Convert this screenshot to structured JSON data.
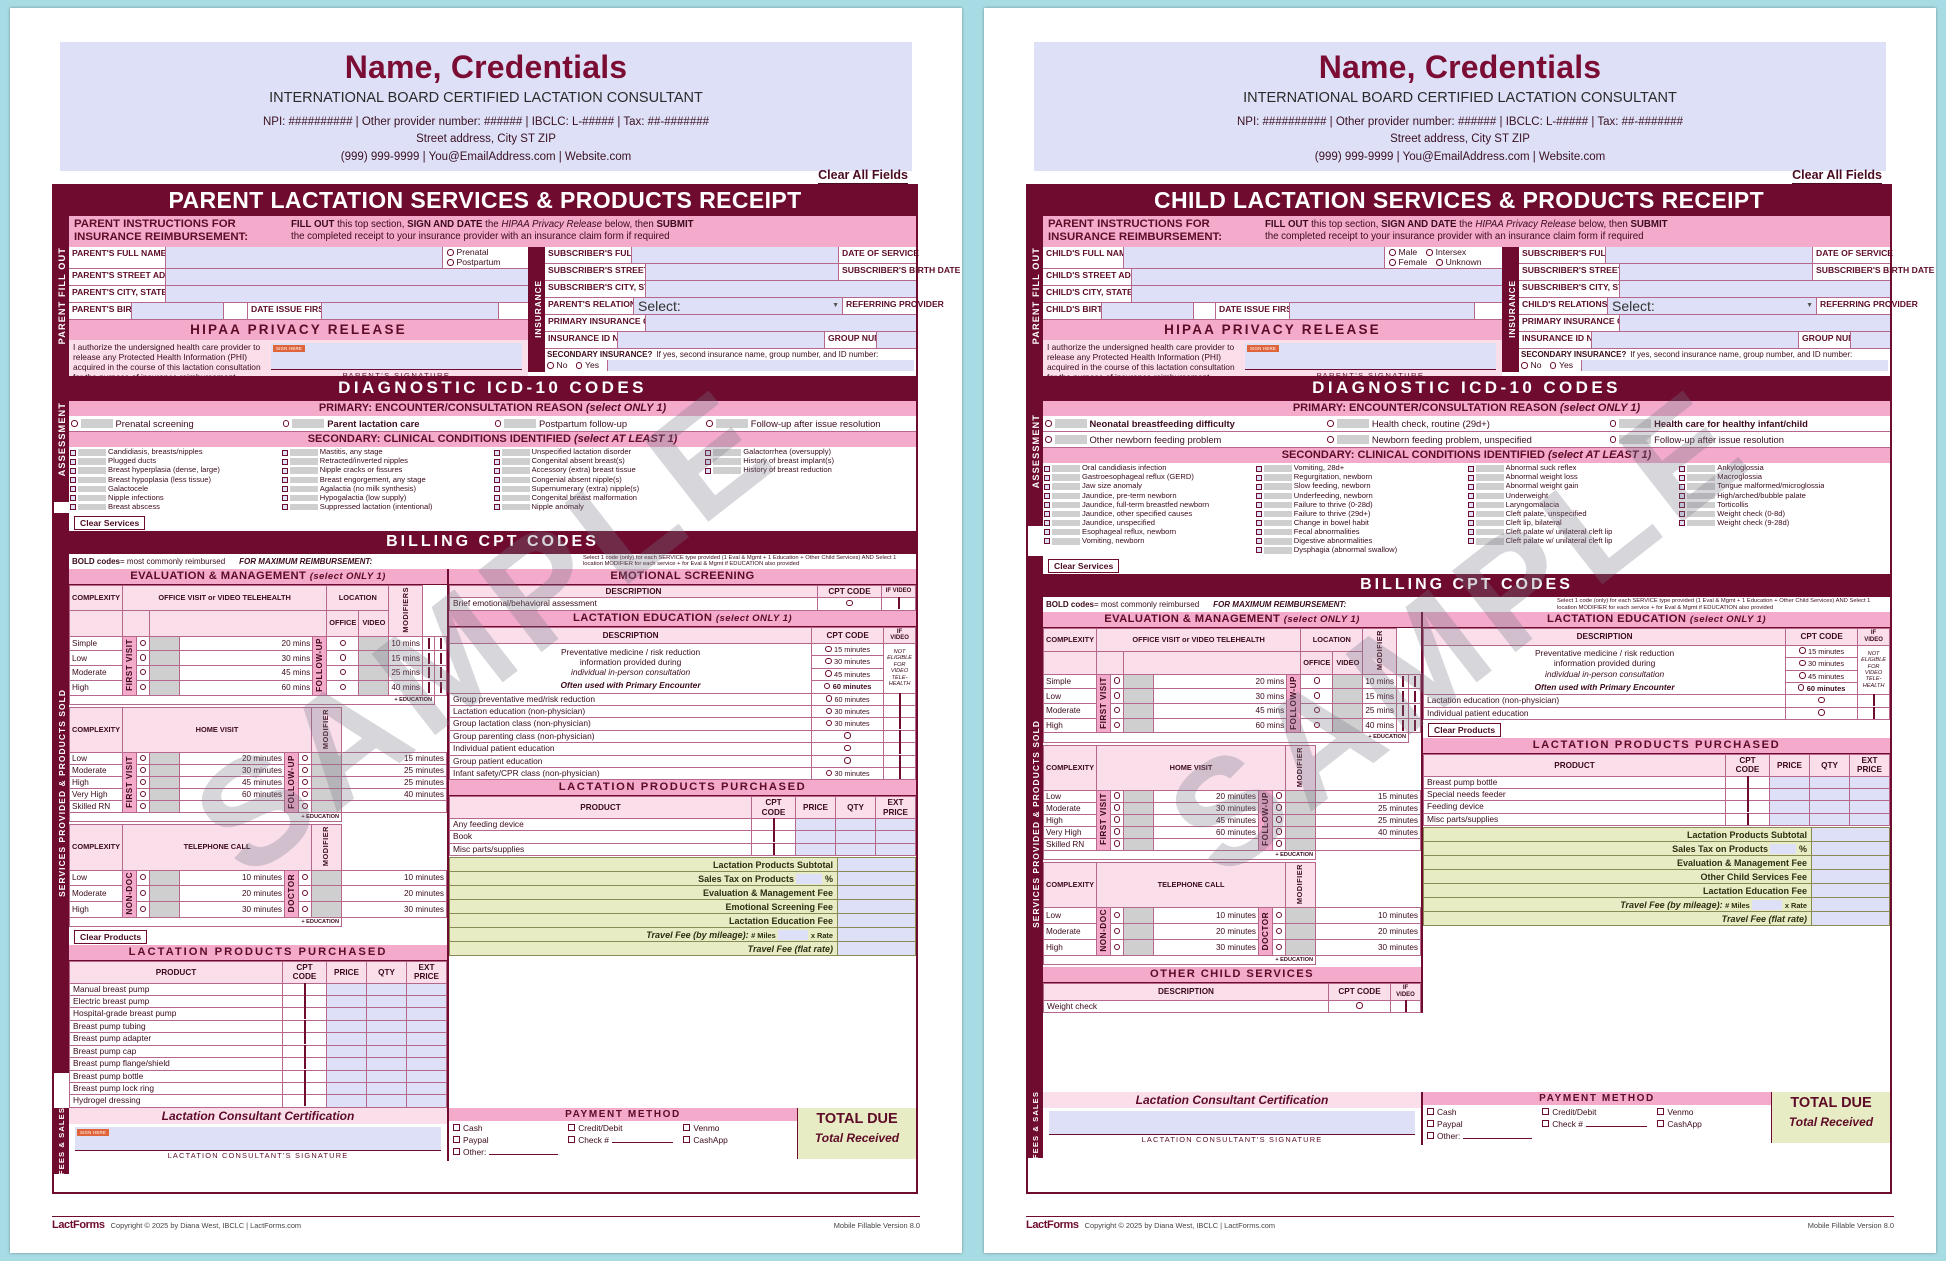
{
  "letterhead": {
    "name": "Name, Credentials",
    "subtitle": "INTERNATIONAL BOARD CERTIFIED LACTATION CONSULTANT",
    "ids": "NPI: ########## | Other provider number: ###### | IBCLC: L-##### | Tax: ##-#######",
    "address": "Street address, City ST ZIP",
    "contact": "(999) 999-9999 | You@EmailAddress.com | Website.com"
  },
  "clear_all_label": "Clear All Fields",
  "watermark": "SAMPLE",
  "forms": {
    "parent": {
      "title": "PARENT LACTATION SERVICES & PRODUCTS RECEIPT",
      "spine_fill": "PARENT FILL OUT",
      "spine_assess": "ASSESSMENT",
      "spine_services": "SERVICES PROVIDED & PRODUCTS SOLD",
      "spine_fees": "FEES & SALES",
      "spine_insurance": "INSURANCE",
      "instructions_label": "PARENT INSTRUCTIONS FOR INSURANCE REIMBURSEMENT:",
      "instructions_l1_a": "FILL OUT",
      "instructions_l1_b": " this top section, ",
      "instructions_l1_c": "SIGN AND DATE",
      "instructions_l1_d": " the ",
      "instructions_l1_e": "HIPAA Privacy Release",
      "instructions_l1_f": " below, then ",
      "instructions_l1_g": "SUBMIT",
      "instructions_l2": "the completed receipt to your insurance provider with an insurance claim form if required",
      "fields_left": [
        "PARENT'S FULL NAME",
        "PARENT'S STREET ADDRESS",
        "PARENT'S CITY, STATE, ZIP",
        "PARENT'S BIRTH DATE"
      ],
      "date_issue_label": "DATE ISSUE FIRST BEGAN",
      "radio_options": [
        "Prenatal",
        "Postpartum"
      ],
      "fields_right": [
        "SUBSCRIBER'S FULL NAME",
        "SUBSCRIBER'S STREET ADDRESS (if different)",
        "SUBSCRIBER'S CITY, STATE, ZIP (if different)"
      ],
      "relationship_label": "PARENT'S RELATIONSHIP TO SUBSCRIBER",
      "select_placeholder": "Select:",
      "primary_ins_label": "PRIMARY INSURANCE COMPANY NAME",
      "ins_id_label": "INSURANCE ID NUMBER",
      "date_of_service_label": "DATE OF SERVICE",
      "subscriber_birth_label": "SUBSCRIBER'S BIRTH DATE",
      "referring_label": "REFERRING PROVIDER",
      "group_number_label": "GROUP NUMBER",
      "secondary_ins_q": "SECONDARY INSURANCE?",
      "secondary_ins_hint": "If yes, second insurance name, group number, and ID number:",
      "secondary_opts": [
        "No",
        "Yes"
      ],
      "hipaa_title": "HIPAA PRIVACY RELEASE",
      "hipaa_text": "I authorize the undersigned health care provider to release any Protected Health Information (PHI) acquired in the course of this lactation consultation for the purpose of insurance reimbursement.",
      "sign_here": "SIGN HERE",
      "signature_caption": "PARENT'S SIGNATURE",
      "icd_title": "DIAGNOSTIC ICD-10 CODES",
      "primary_band_a": "PRIMARY:  ENCOUNTER/CONSULTATION REASON ",
      "primary_band_b": "(select ONLY 1)",
      "primary_options": [
        {
          "label": "Prenatal screening",
          "bold": false
        },
        {
          "label": "Parent lactation care",
          "bold": true
        },
        {
          "label": "Postpartum follow-up",
          "bold": false
        },
        {
          "label": "Follow-up after issue resolution",
          "bold": false
        }
      ],
      "secondary_band_a": "SECONDARY:  CLINICAL CONDITIONS IDENTIFIED ",
      "secondary_band_b": "(select AT LEAST 1)",
      "conditions": [
        [
          "Candidiasis, breasts/nipples",
          "Plugged ducts",
          "Breast hyperplasia (dense, large)",
          "Breast hypoplasia (less tissue)",
          "Galactocele",
          "Nipple infections",
          "Breast abscess"
        ],
        [
          "Mastitis, any stage",
          "Retracted/inverted nipples",
          "Nipple cracks or fissures",
          "Breast engorgement, any stage",
          "Agalactia (no milk synthesis)",
          "Hypogalactia (low supply)",
          "Suppressed lactation (intentional)"
        ],
        [
          "Unspecified lactation disorder",
          "Congenital absent breast(s)",
          "Accessory (extra) breast tissue",
          "Congenial absent nipple(s)",
          "Supernumerary (extra) nipple(s)",
          "Congenital breast malformation",
          "Nipple anomaly"
        ],
        [
          "Galactorrhea (oversupply)",
          "History of breast implant(s)",
          "History of breast reduction"
        ]
      ],
      "clear_services": "Clear Services",
      "billing_title": "BILLING CPT CODES",
      "bold_note_a": "BOLD codes",
      "bold_note_b": " = most commonly reimbursed",
      "max_reimb": "FOR MAXIMUM REIMBURSEMENT:",
      "max_reimb_detail": "Select 1 code (only) for each SERVICE type provided (1 Eval & Mgmt + 1 Education + Other Child Services) AND Select 1 location MODIFIER for each service + for Eval & Mgmt if EDUCATION also provided",
      "em_title_a": "EVALUATION & MANAGEMENT ",
      "em_title_b": "(select ONLY 1)",
      "office_visit_hdr": "OFFICE VISIT or VIDEO TELEHEALTH",
      "complexity_hdr": "COMPLEXITY",
      "location_hdr": "LOCATION",
      "office_hdr": "OFFICE",
      "video_hdr": "VIDEO",
      "education_hdr": "+ EDUCATION",
      "modifiers_hdr": "MODIFIERS",
      "modifier_hdr": "MODIFIER",
      "first_visit_rail": "FIRST VISIT",
      "follow_up_rail": "FOLLOW-UP",
      "office_rows": [
        {
          "complexity": "Simple",
          "first": "20 mins",
          "follow": "10 mins"
        },
        {
          "complexity": "Low",
          "first": "30 mins",
          "follow": "15 mins"
        },
        {
          "complexity": "Moderate",
          "first": "45 mins",
          "follow": "25 mins"
        },
        {
          "complexity": "High",
          "first": "60 mins",
          "follow": "40 mins"
        }
      ],
      "home_visit_hdr": "HOME VISIT",
      "home_rows": [
        {
          "complexity": "Low",
          "first": "20 minutes",
          "follow": "15 minutes"
        },
        {
          "complexity": "Moderate",
          "first": "30 minutes",
          "follow": "25 minutes"
        },
        {
          "complexity": "High",
          "first": "45 minutes",
          "follow": "25 minutes"
        },
        {
          "complexity": "Very High",
          "first": "60 minutes",
          "follow": "40 minutes"
        },
        {
          "complexity": "Skilled RN",
          "first": "",
          "follow": ""
        }
      ],
      "telephone_hdr": "TELEPHONE CALL",
      "nonphysician_rail": "NON-DOC",
      "doctor_rail": "DOCTOR",
      "phone_rows": [
        {
          "complexity": "Low",
          "first": "10 minutes",
          "follow": "10 minutes"
        },
        {
          "complexity": "Moderate",
          "first": "20 minutes",
          "follow": "20 minutes"
        },
        {
          "complexity": "High",
          "first": "30 minutes",
          "follow": "30 minutes"
        }
      ],
      "emotional_title": "EMOTIONAL SCREENING",
      "desc_hdr": "DESCRIPTION",
      "cpt_hdr": "CPT CODE",
      "ifvideo_hdr": "IF VIDEO",
      "emotional_rows": [
        "Brief emotional/behavioral assessment"
      ],
      "lact_edu_title_a": "LACTATION EDUCATION ",
      "lact_edu_title_b": "(select ONLY 1)",
      "prev_med_l1": "Preventative medicine / risk reduction",
      "prev_med_l2": "information provided during",
      "prev_med_l3": "individual in-person consultation",
      "prev_med_l4": "Often used with Primary Encounter",
      "not_eligible": "NOT ELIGIBLE FOR VIDEO TELE-HEALTH",
      "prev_med_times": [
        "15 minutes",
        "30 minutes",
        "45 minutes",
        "60 minutes"
      ],
      "edu_rows": [
        {
          "label": "Group preventative med/risk reduction",
          "time": "60 minutes"
        },
        {
          "label": "Lactation education (non-physician)",
          "time": "30 minutes"
        },
        {
          "label": "Group lactation class (non-physician)",
          "time": "30 minutes"
        },
        {
          "label": "Group parenting class (non-physician)",
          "time": ""
        },
        {
          "label": "Individual patient education",
          "time": ""
        },
        {
          "label": "Group patient education",
          "time": ""
        },
        {
          "label": "Infant safety/CPR class (non-physician)",
          "time": "30 minutes"
        }
      ],
      "clear_products": "Clear Products",
      "products_title": "LACTATION PRODUCTS PURCHASED",
      "product_cols": [
        "PRODUCT",
        "CPT CODE",
        "PRICE",
        "QTY",
        "EXT PRICE"
      ],
      "products_left": [
        "Manual breast pump",
        "Electric breast pump",
        "Hospital-grade breast pump",
        "Breast pump tubing",
        "Breast pump adapter",
        "Breast pump cap",
        "Breast pump flange/shield",
        "Breast pump bottle",
        "Breast pump lock ring",
        "Hydrogel dressing"
      ],
      "products_right": [
        "Any feeding device",
        "Book",
        "Misc parts/supplies"
      ],
      "cert_title": "Lactation Consultant Certification",
      "cert_caption": "LACTATION CONSULTANT'S SIGNATURE",
      "totals": [
        {
          "label": "Lactation Products Subtotal",
          "value": ""
        },
        {
          "label": "Sales Tax on Products",
          "value": "%"
        },
        {
          "label": "Evaluation & Management Fee",
          "value": ""
        },
        {
          "label": "Emotional Screening Fee",
          "value": ""
        },
        {
          "label": "Lactation Education Fee",
          "value": ""
        }
      ],
      "travel_label_a": "Travel Fee ",
      "travel_label_b": "(by mileage):",
      "travel_miles": "# Miles",
      "travel_rate": "x Rate",
      "travel_flat_a": "Travel Fee ",
      "travel_flat_b": "(flat rate)",
      "total_due": "TOTAL DUE",
      "total_received": "Total Received",
      "payment_title": "PAYMENT METHOD",
      "payment_methods": [
        "Cash",
        "Credit/Debit",
        "Venmo",
        "Paypal",
        "Check #",
        "CashApp",
        "Other:"
      ],
      "footer_copyright": "Copyright © 2025 by Diana West, IBCLC  |  LactForms.com",
      "footer_version": "Mobile Fillable Version 8.0",
      "footer_logo": "LactForms"
    },
    "child": {
      "title": "CHILD LACTATION SERVICES & PRODUCTS RECEIPT",
      "fields_left": [
        "CHILD'S FULL NAME",
        "CHILD'S STREET ADDRESS",
        "CHILD'S CITY, STATE, ZIP",
        "CHILD'S BIRTH DATE"
      ],
      "radio_options_a": [
        "Male",
        "Intersex"
      ],
      "radio_options_b": [
        "Female",
        "Unknown"
      ],
      "fields_right": [
        "SUBSCRIBER'S FULL NAME",
        "SUBSCRIBER'S STREET ADDRESS (if different)",
        "SUBSCRIBER'S CITY, STATE, ZIP (if different)"
      ],
      "relationship_label": "CHILD'S RELATIONSHIP TO SUBSCRIBER",
      "primary_options": [
        {
          "label": "Neonatal breastfeeding difficulty",
          "bold": true
        },
        {
          "label": "Other newborn feeding problem",
          "bold": false
        },
        {
          "label": "Health check, routine (29d+)",
          "bold": false
        },
        {
          "label": "Newborn feeding problem, unspecified",
          "bold": false
        },
        {
          "label": "Health care for healthy infant/child",
          "bold": true
        },
        {
          "label": "Follow-up after issue resolution",
          "bold": false
        }
      ],
      "conditions": [
        [
          "Oral candidiasis infection",
          "Gastroesophageal reflux (GERD)",
          "Jaw size anomaly",
          "Jaundice, pre-term newborn",
          "Jaundice, full-term breastfed newborn",
          "Jaundice, other specified causes",
          "Jaundice, unspecified",
          "Esophageal reflux, newborn",
          "Vomiting, newborn"
        ],
        [
          "Vomiting, 28d+",
          "Regurgitation, newborn",
          "Slow feeding, newborn",
          "Underfeeding, newborn",
          "Failure to thrive (0-28d)",
          "Failure to thrive (29d+)",
          "Change in bowel habit",
          "Fecal abnormalities",
          "Digestive abnormalities",
          "Dysphagia (abnormal swallow)"
        ],
        [
          "Abnormal suck reflex",
          "Abnormal weight loss",
          "Abnormal weight gain",
          "Underweight",
          "Laryngomalacia",
          "Cleft palate, unspecified",
          "Cleft lip, bilateral",
          "Cleft palate w/ unilateral cleft lip",
          "Cleft palate w/ unilateral cleft lip"
        ],
        [
          "Ankyloglossia",
          "Macroglossia",
          "Tongue malformed/microglossia",
          "High/arched/bubble palate",
          "Torticollis",
          "Weight check (0-8d)",
          "Weight check (9-28d)"
        ]
      ],
      "other_services_title": "OTHER CHILD SERVICES",
      "other_services_rows": [
        "Weight check"
      ],
      "edu_rows": [
        {
          "label": "Lactation education (non-physician)",
          "time": ""
        },
        {
          "label": "Individual patient education",
          "time": ""
        }
      ],
      "products_left": [
        "Breast pump bottle",
        "Special needs feeder",
        "Feeding device",
        "Misc parts/supplies"
      ],
      "totals": [
        {
          "label": "Lactation Products Subtotal",
          "value": ""
        },
        {
          "label": "Sales Tax on Products",
          "value": "%"
        },
        {
          "label": "Evaluation & Management Fee",
          "value": ""
        },
        {
          "label": "Other Child Services Fee",
          "value": ""
        },
        {
          "label": "Lactation Education Fee",
          "value": ""
        }
      ]
    }
  }
}
